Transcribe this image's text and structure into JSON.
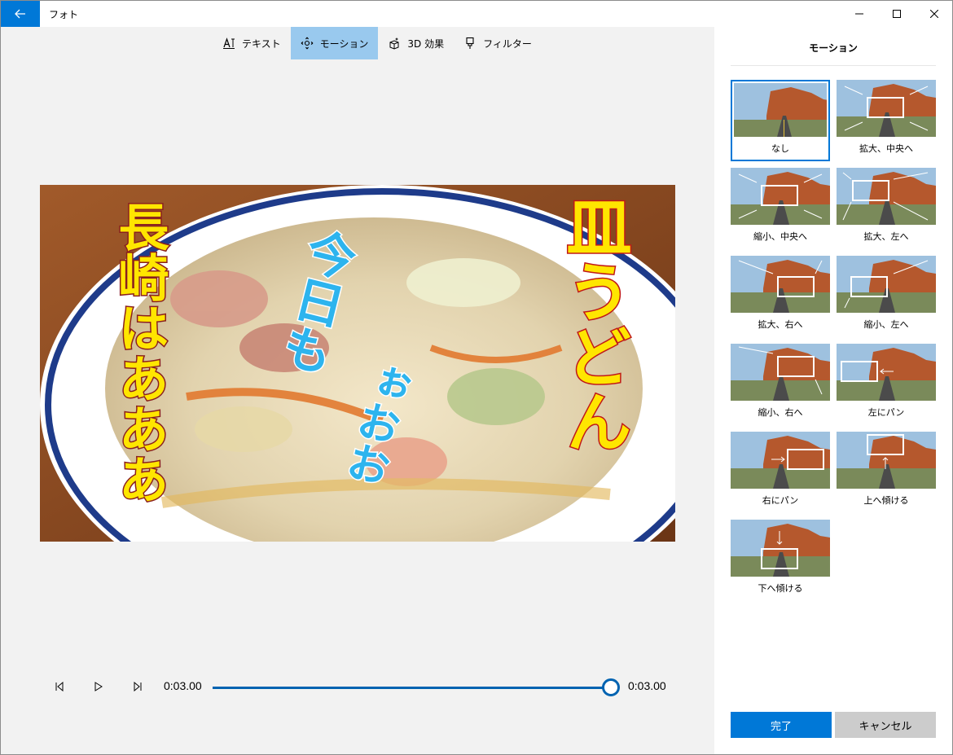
{
  "window": {
    "title": "フォト"
  },
  "toolbar": {
    "items": [
      {
        "label": "テキスト",
        "icon": "text-icon"
      },
      {
        "label": "モーション",
        "icon": "motion-icon",
        "active": true
      },
      {
        "label": "3D 効果",
        "icon": "3d-effects-icon"
      },
      {
        "label": "フィルター",
        "icon": "filter-icon"
      }
    ]
  },
  "preview": {
    "title_left": "長崎はあああ",
    "title_middle": "今日も",
    "title_middle2": "ぉおお",
    "title_right": "皿うどん"
  },
  "playback": {
    "current_time": "0:03.00",
    "end_time": "0:03.00",
    "progress": 1.0
  },
  "panel": {
    "title": "モーション",
    "options": [
      {
        "label": "なし",
        "selected": true
      },
      {
        "label": "拡大、中央へ"
      },
      {
        "label": "縮小、中央へ"
      },
      {
        "label": "拡大、左へ"
      },
      {
        "label": "拡大、右へ"
      },
      {
        "label": "縮小、左へ"
      },
      {
        "label": "縮小、右へ"
      },
      {
        "label": "左にパン"
      },
      {
        "label": "右にパン"
      },
      {
        "label": "上へ傾ける"
      },
      {
        "label": "下へ傾ける"
      }
    ],
    "done_label": "完了",
    "cancel_label": "キャンセル"
  },
  "colors": {
    "accent": "#0078d7",
    "active_tool": "#99c9ee",
    "cancel_bg": "#cccccc",
    "preview_yellow": "#ffe600",
    "preview_cyan": "#2db4ee"
  }
}
